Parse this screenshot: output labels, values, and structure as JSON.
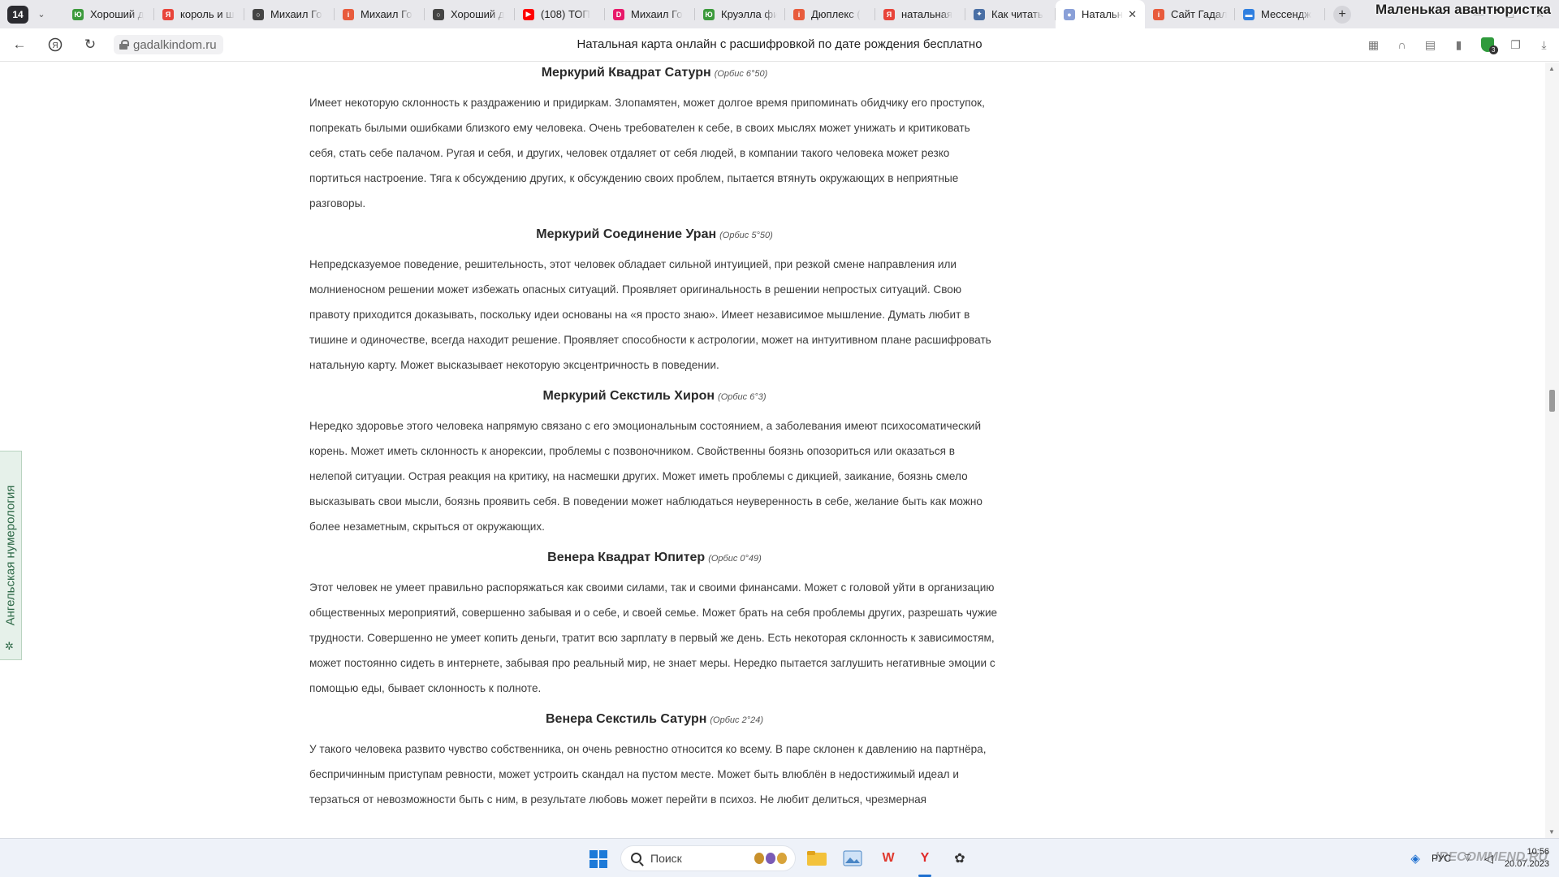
{
  "browser": {
    "tab_count": "14",
    "tabs": [
      {
        "label": "Хороший д",
        "icon": "green-site-icon",
        "color": "#3c9a3c",
        "glyph": "Ю"
      },
      {
        "label": "король и ш",
        "icon": "yandex-icon",
        "color": "#e8443a",
        "glyph": "Я"
      },
      {
        "label": "Михаил Го",
        "icon": "pendant-icon",
        "color": "#444444",
        "glyph": "○"
      },
      {
        "label": "Михаил Го",
        "icon": "irecommend-icon",
        "color": "#e85b3c",
        "glyph": "i"
      },
      {
        "label": "Хороший д",
        "icon": "pendant-icon",
        "color": "#444444",
        "glyph": "○"
      },
      {
        "label": "(108) ТОП",
        "icon": "youtube-icon",
        "color": "#ff0000",
        "glyph": "▶"
      },
      {
        "label": "Михаил Го",
        "icon": "dzen-icon",
        "color": "#e8196a",
        "glyph": "D"
      },
      {
        "label": "Круэлла фи",
        "icon": "green-site-icon",
        "color": "#3c9a3c",
        "glyph": "Ю"
      },
      {
        "label": "Дюплекс (",
        "icon": "irecommend-icon",
        "color": "#e85b3c",
        "glyph": "i"
      },
      {
        "label": "натальная",
        "icon": "yandex-icon",
        "color": "#e8443a",
        "glyph": "Я"
      },
      {
        "label": "Как читать",
        "icon": "settings-icon",
        "color": "#4a6fa5",
        "glyph": "✦"
      },
      {
        "label": "Натальн",
        "icon": "profile-icon",
        "color": "#8aa0d8",
        "glyph": "●",
        "active": true
      },
      {
        "label": "Сайт Гадал",
        "icon": "irecommend-icon",
        "color": "#e85b3c",
        "glyph": "i"
      },
      {
        "label": "Мессендж",
        "icon": "messenger-icon",
        "color": "#2f7fe0",
        "glyph": "▬"
      }
    ],
    "strip_title": "Маленькая авантюристка",
    "url": "gadalkindom.ru",
    "page_title": "Натальная карта онлайн с расшифровкой по дате рождения бесплатно"
  },
  "article": {
    "sections": [
      {
        "title": "Меркурий Квадрат Сатурн",
        "orb": "(Орбис 6°50)",
        "text": "Имеет некоторую склонность к раздражению и придиркам. Злопамятен, может долгое время припоминать обидчику его проступок, попрекать былыми ошибками близкого ему человека. Очень требователен к себе, в своих мыслях может унижать и критиковать себя, стать себе палачом. Ругая и себя, и других, человек отдаляет от себя людей, в компании такого человека может резко портиться настроение. Тяга к обсуждению других, к обсуждению своих проблем, пытается втянуть окружающих в неприятные разговоры."
      },
      {
        "title": "Меркурий Соединение Уран",
        "orb": "(Орбис 5°50)",
        "text": "Непредсказуемое поведение, решительность, этот человек обладает сильной интуицией, при резкой смене направления или молниеносном решении может избежать опасных ситуаций. Проявляет оригинальность в решении непростых ситуаций. Свою правоту приходится доказывать, поскольку идеи основаны на «я просто знаю». Имеет независимое мышление. Думать любит в тишине и одиночестве, всегда находит решение. Проявляет способности к астрологии, может на интуитивном плане расшифровать натальную карту. Может высказывает некоторую эксцентричность в поведении."
      },
      {
        "title": "Меркурий Секстиль Хирон",
        "orb": "(Орбис 6°3)",
        "text": "Нередко здоровье этого человека напрямую связано с его эмоциональным состоянием, а заболевания имеют психосоматический корень. Может иметь склонность к анорексии, проблемы с позвоночником. Свойственны боязнь опозориться или оказаться в нелепой ситуации. Острая реакция на критику, на насмешки других. Может иметь проблемы с дикцией, заикание, боязнь смело высказывать свои мысли, боязнь проявить себя. В поведении может наблюдаться неуверенность в себе, желание быть как можно более незаметным, скрыться от окружающих."
      },
      {
        "title": "Венера Квадрат Юпитер",
        "orb": "(Орбис 0°49)",
        "text": "Этот человек не умеет правильно распоряжаться как своими силами, так и своими финансами. Может с головой уйти в организацию общественных мероприятий, совершенно забывая и о себе, и своей семье. Может брать на себя проблемы других, разрешать чужие трудности. Совершенно не умеет копить деньги, тратит всю зарплату в первый же день. Есть некоторая склонность к зависимостям, может постоянно сидеть в интернете, забывая про реальный мир, не знает меры. Нередко пытается заглушить негативные эмоции с помощью еды, бывает склонность к полноте."
      },
      {
        "title": "Венера Секстиль Сатурн",
        "orb": "(Орбис 2°24)",
        "text": "У такого человека развито чувство собственника, он очень ревностно относится ко всему. В паре склонен к давлению на партнёра, беспричинным приступам ревности, может устроить скандал на пустом месте. Может быть влюблён в недостижимый идеал и терзаться от невозможности быть с ним, в результате любовь может перейти в психоз. Не любит делиться, чрезмерная"
      }
    ]
  },
  "side_tab": {
    "label": "Ангельская нумерология"
  },
  "taskbar": {
    "search_placeholder": "Поиск",
    "lang": "РУС",
    "time": "10:56",
    "date": "20.07.2023",
    "watermark": "IRECOMMEND.RU"
  }
}
